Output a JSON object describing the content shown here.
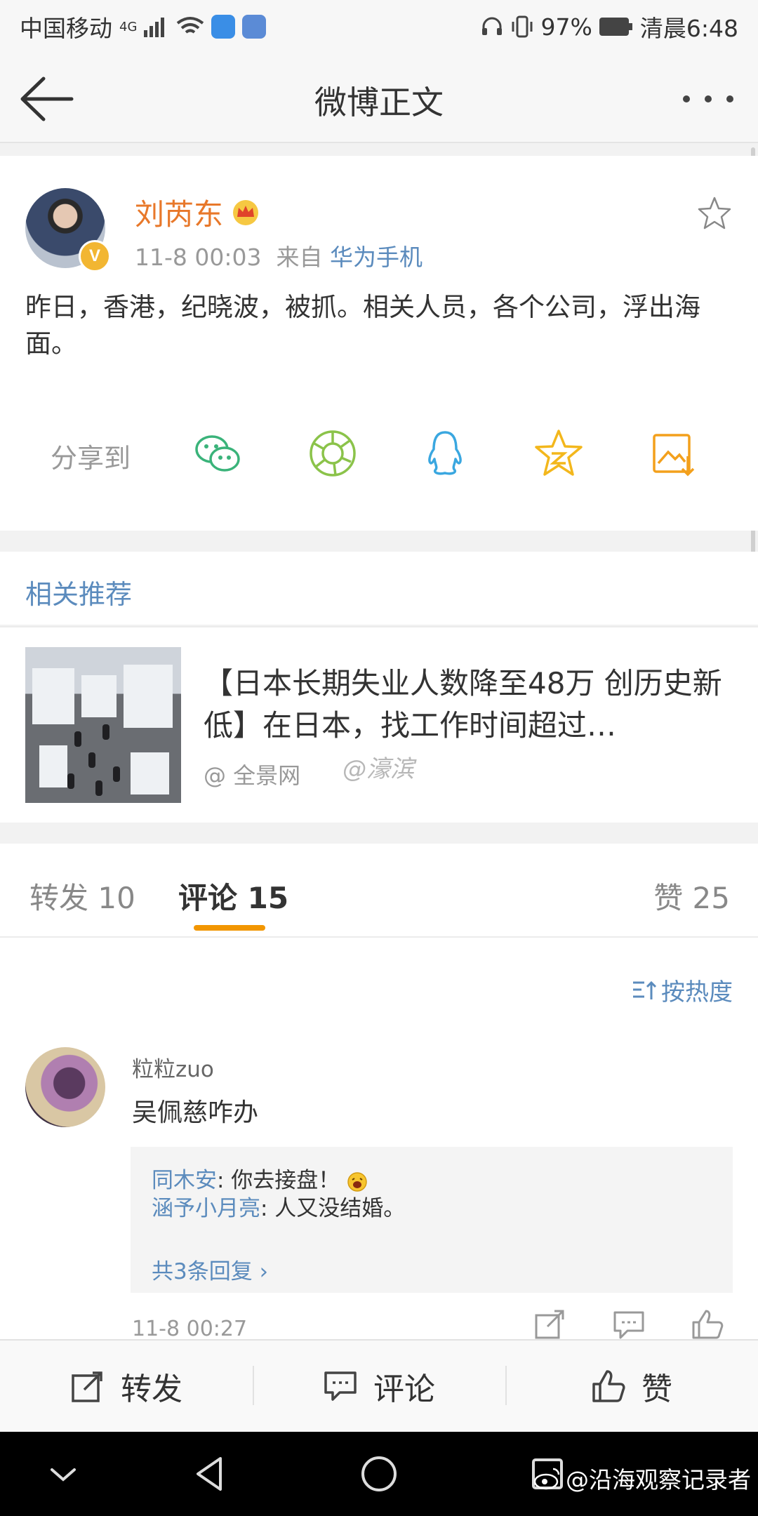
{
  "status_bar": {
    "carrier": "中国移动",
    "network": "4G",
    "battery": "97%",
    "time": "清晨6:48"
  },
  "nav": {
    "title": "微博正文"
  },
  "post": {
    "author": "刘芮东",
    "timestamp": "11-8 00:03",
    "source_prefix": "来自",
    "source": "华为手机",
    "text": "昨日，香港，纪晓波，被抓。相关人员，各个公司，浮出海面。",
    "share_label": "分享到",
    "share_targets": [
      "wechat-icon",
      "moments-icon",
      "qq-icon",
      "qzone-icon",
      "save-image-icon"
    ]
  },
  "recommend": {
    "header": "相关推荐",
    "headline": "【日本长期失业人数降至48万 创历史新低】在日本，找工作时间超过…",
    "source": "@ 全景网",
    "watermark": "@濠滨"
  },
  "tabs": {
    "repost": "转发 10",
    "comment": "评论 15",
    "like": "赞 25"
  },
  "comments": {
    "sort_label": "按热度",
    "items": [
      {
        "user": "粒粒zuo",
        "text": "吴佩慈咋办",
        "replies": [
          {
            "user": "同木安",
            "text": ": 你去接盘！"
          },
          {
            "user": "涵予小月亮",
            "text": ": 人又没结婚。"
          }
        ],
        "more": "共3条回复 ›",
        "time": "11-8 00:27"
      }
    ]
  },
  "bottom_bar": {
    "repost": "转发",
    "comment": "评论",
    "like": "赞"
  },
  "system": {
    "watermark": "@沿海观察记录者"
  },
  "colors": {
    "accent_orange": "#f29600",
    "author_orange": "#e8782a",
    "link_blue": "#5b8bbd"
  }
}
